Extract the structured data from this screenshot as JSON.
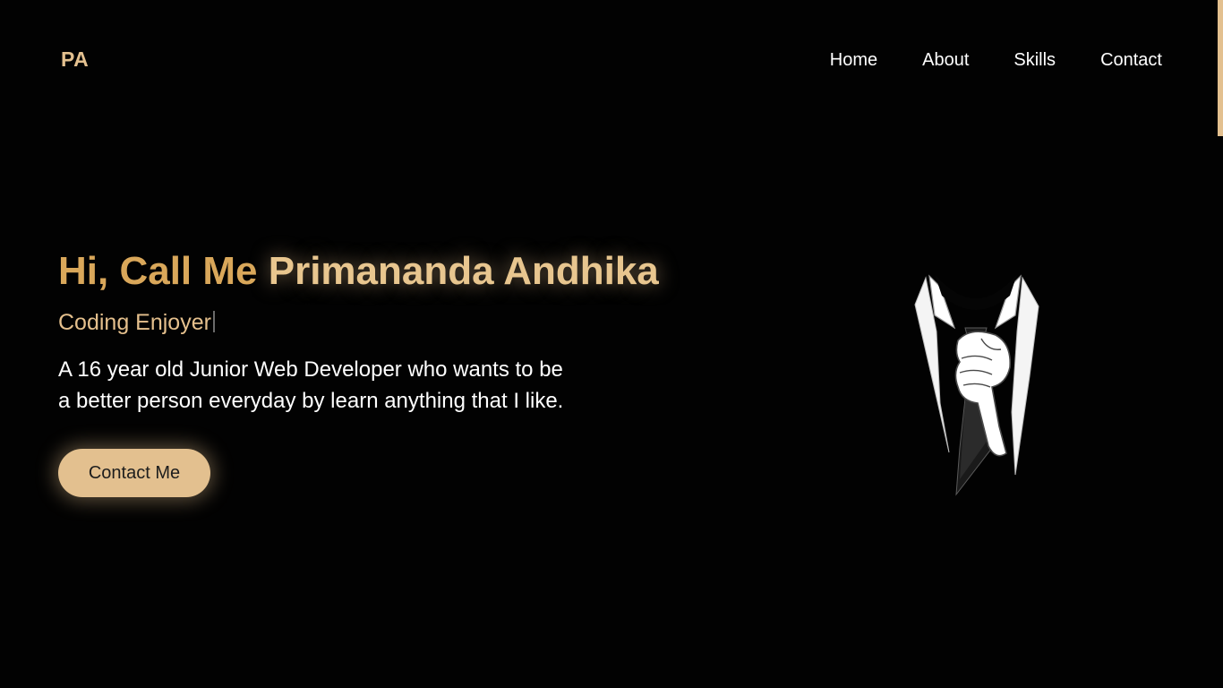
{
  "header": {
    "logo_text": "PA",
    "nav": [
      {
        "label": "Home"
      },
      {
        "label": "About"
      },
      {
        "label": "Skills"
      },
      {
        "label": "Contact"
      }
    ]
  },
  "hero": {
    "greeting": "Hi, Call Me",
    "name": "Primananda Andhika",
    "subtitle": "Coding Enjoyer",
    "description_line1": "A 16 year old Junior Web Developer who wants to be",
    "description_line2": "a better person everyday by learn anything that I like.",
    "cta_label": "Contact Me"
  },
  "colors": {
    "background": "#020202",
    "accent_gold": "#e3c08f",
    "greeting_gold": "#d9a75a",
    "text": "#ffffff"
  },
  "icons": {
    "illustration": "suit-tie-illustration"
  }
}
